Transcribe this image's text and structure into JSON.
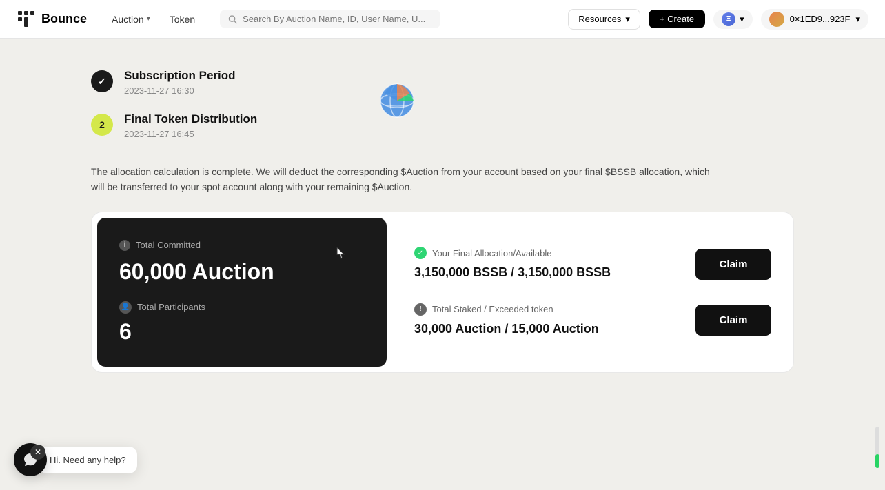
{
  "app": {
    "logo_text": "Bounce",
    "nav": {
      "auction_label": "Auction",
      "token_label": "Token",
      "search_placeholder": "Search By Auction Name, ID, User Name, U...",
      "resources_label": "Resources",
      "create_label": "+ Create",
      "wallet_address": "0×1ED9...923F"
    }
  },
  "timeline": {
    "step1": {
      "step_number": "✓",
      "title": "Subscription Period",
      "timestamp": "2023-11-27 16:30"
    },
    "step2": {
      "step_number": "2",
      "title": "Final Token Distribution",
      "timestamp": "2023-11-27 16:45"
    }
  },
  "description": "The allocation calculation is complete. We will deduct the corresponding $Auction from your account based on your final $BSSB allocation, which will be transferred to your spot account along with your remaining $Auction.",
  "dark_panel": {
    "committed_label": "Total Committed",
    "committed_value": "60,000 Auction",
    "participants_label": "Total Participants",
    "participants_value": "6"
  },
  "right_panel": {
    "allocation_label": "Your Final Allocation/Available",
    "allocation_value": "3,150,000 BSSB / 3,150,000 BSSB",
    "claim_label_1": "Claim",
    "staked_label": "Total Staked / Exceeded token",
    "staked_value": "30,000 Auction / 15,000 Auction",
    "claim_label_2": "Claim"
  },
  "chat": {
    "message": "Hi. Need any help?"
  },
  "colors": {
    "accent_green": "#2ed573",
    "dark_bg": "#1a1a1a",
    "step_active": "#d4e84a"
  }
}
